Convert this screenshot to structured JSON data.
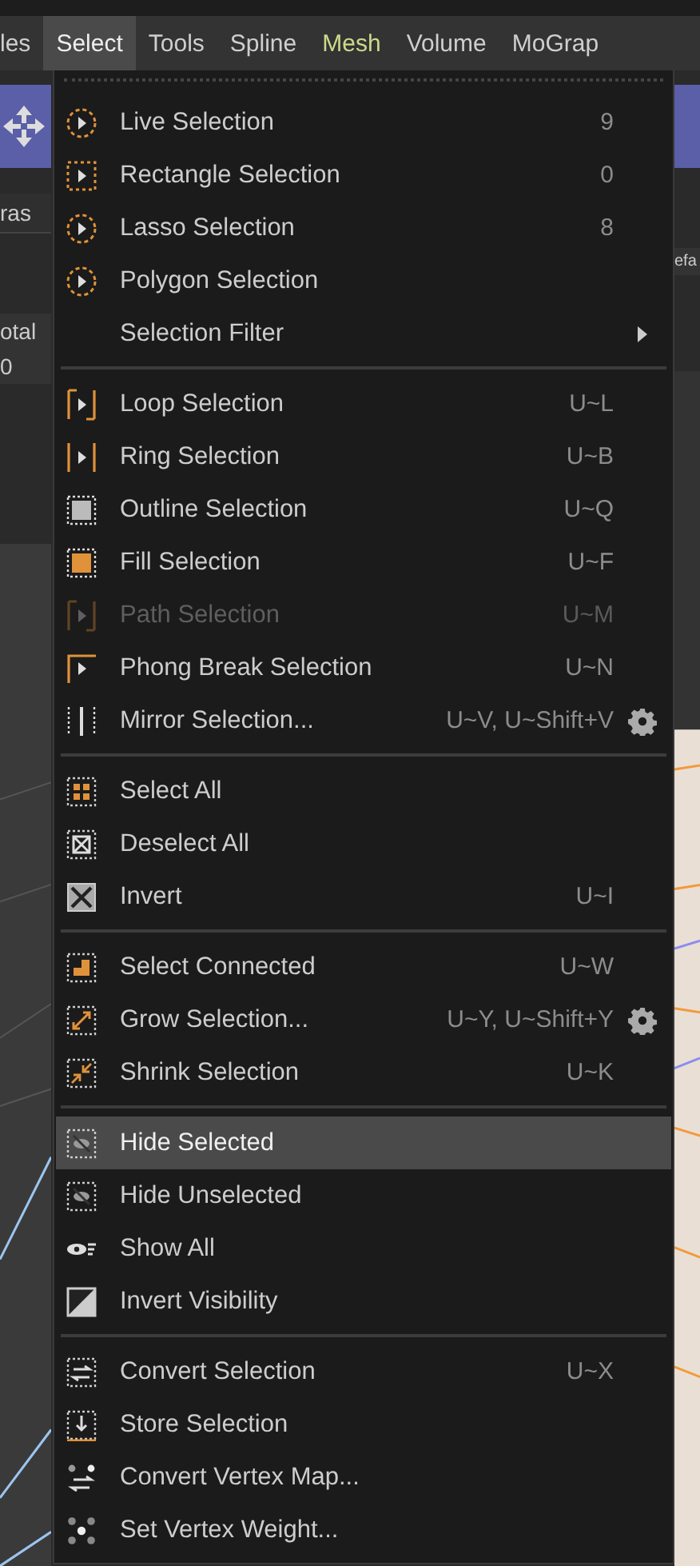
{
  "menubar": [
    {
      "label": "les",
      "selected": false
    },
    {
      "label": "Select",
      "selected": true
    },
    {
      "label": "Tools",
      "selected": false
    },
    {
      "label": "Spline",
      "selected": false
    },
    {
      "label": "Mesh",
      "selected": false,
      "color": "#cdd98a"
    },
    {
      "label": "Volume",
      "selected": false
    },
    {
      "label": "MoGrap",
      "selected": false
    }
  ],
  "background_texts": {
    "left_tab": "ras",
    "left_label": "otal",
    "left_value": "0",
    "right_label": "efa"
  },
  "menu": {
    "sections": [
      [
        {
          "label": "Live Selection",
          "shortcut": "9",
          "gear": false,
          "submenu": false,
          "disabled": false,
          "selected": false
        },
        {
          "label": "Rectangle Selection",
          "shortcut": "0",
          "gear": false,
          "submenu": false,
          "disabled": false,
          "selected": false
        },
        {
          "label": "Lasso Selection",
          "shortcut": "8",
          "gear": false,
          "submenu": false,
          "disabled": false,
          "selected": false
        },
        {
          "label": "Polygon Selection",
          "gear": false,
          "submenu": false,
          "disabled": false,
          "selected": false
        },
        {
          "label": "Selection Filter",
          "gear": false,
          "submenu": true,
          "disabled": false,
          "selected": false
        }
      ],
      [
        {
          "label": "Loop Selection",
          "shortcut": "U~L",
          "gear": false,
          "submenu": false,
          "disabled": false,
          "selected": false
        },
        {
          "label": "Ring Selection",
          "shortcut": "U~B",
          "gear": false,
          "submenu": false,
          "disabled": false,
          "selected": false
        },
        {
          "label": "Outline Selection",
          "shortcut": "U~Q",
          "gear": false,
          "submenu": false,
          "disabled": false,
          "selected": false
        },
        {
          "label": "Fill Selection",
          "shortcut": "U~F",
          "gear": false,
          "submenu": false,
          "disabled": false,
          "selected": false
        },
        {
          "label": "Path Selection",
          "shortcut": "U~M",
          "gear": false,
          "submenu": false,
          "disabled": true,
          "selected": false
        },
        {
          "label": "Phong Break Selection",
          "shortcut": "U~N",
          "gear": false,
          "submenu": false,
          "disabled": false,
          "selected": false
        },
        {
          "label": "Mirror Selection...",
          "shortcut": "U~V, U~Shift+V",
          "gear": true,
          "submenu": false,
          "disabled": false,
          "selected": false
        }
      ],
      [
        {
          "label": "Select All",
          "gear": false,
          "submenu": false,
          "disabled": false,
          "selected": false
        },
        {
          "label": "Deselect All",
          "gear": false,
          "submenu": false,
          "disabled": false,
          "selected": false
        },
        {
          "label": "Invert",
          "shortcut": "U~I",
          "gear": false,
          "submenu": false,
          "disabled": false,
          "selected": false
        }
      ],
      [
        {
          "label": "Select Connected",
          "shortcut": "U~W",
          "gear": false,
          "submenu": false,
          "disabled": false,
          "selected": false
        },
        {
          "label": "Grow Selection...",
          "shortcut": "U~Y, U~Shift+Y",
          "gear": true,
          "submenu": false,
          "disabled": false,
          "selected": false
        },
        {
          "label": "Shrink Selection",
          "shortcut": "U~K",
          "gear": false,
          "submenu": false,
          "disabled": false,
          "selected": false
        }
      ],
      [
        {
          "label": "Hide Selected",
          "gear": false,
          "submenu": false,
          "disabled": false,
          "selected": true
        },
        {
          "label": "Hide Unselected",
          "gear": false,
          "submenu": false,
          "disabled": false,
          "selected": false
        },
        {
          "label": "Show All",
          "gear": false,
          "submenu": false,
          "disabled": false,
          "selected": false
        },
        {
          "label": "Invert Visibility",
          "gear": false,
          "submenu": false,
          "disabled": false,
          "selected": false
        }
      ],
      [
        {
          "label": "Convert Selection",
          "shortcut": "U~X",
          "gear": false,
          "submenu": false,
          "disabled": false,
          "selected": false
        },
        {
          "label": "Store Selection",
          "gear": false,
          "submenu": false,
          "disabled": false,
          "selected": false
        },
        {
          "label": "Convert Vertex Map...",
          "gear": false,
          "submenu": false,
          "disabled": false,
          "selected": false
        },
        {
          "label": "Set Vertex Weight...",
          "gear": false,
          "submenu": false,
          "disabled": false,
          "selected": false
        }
      ]
    ]
  }
}
